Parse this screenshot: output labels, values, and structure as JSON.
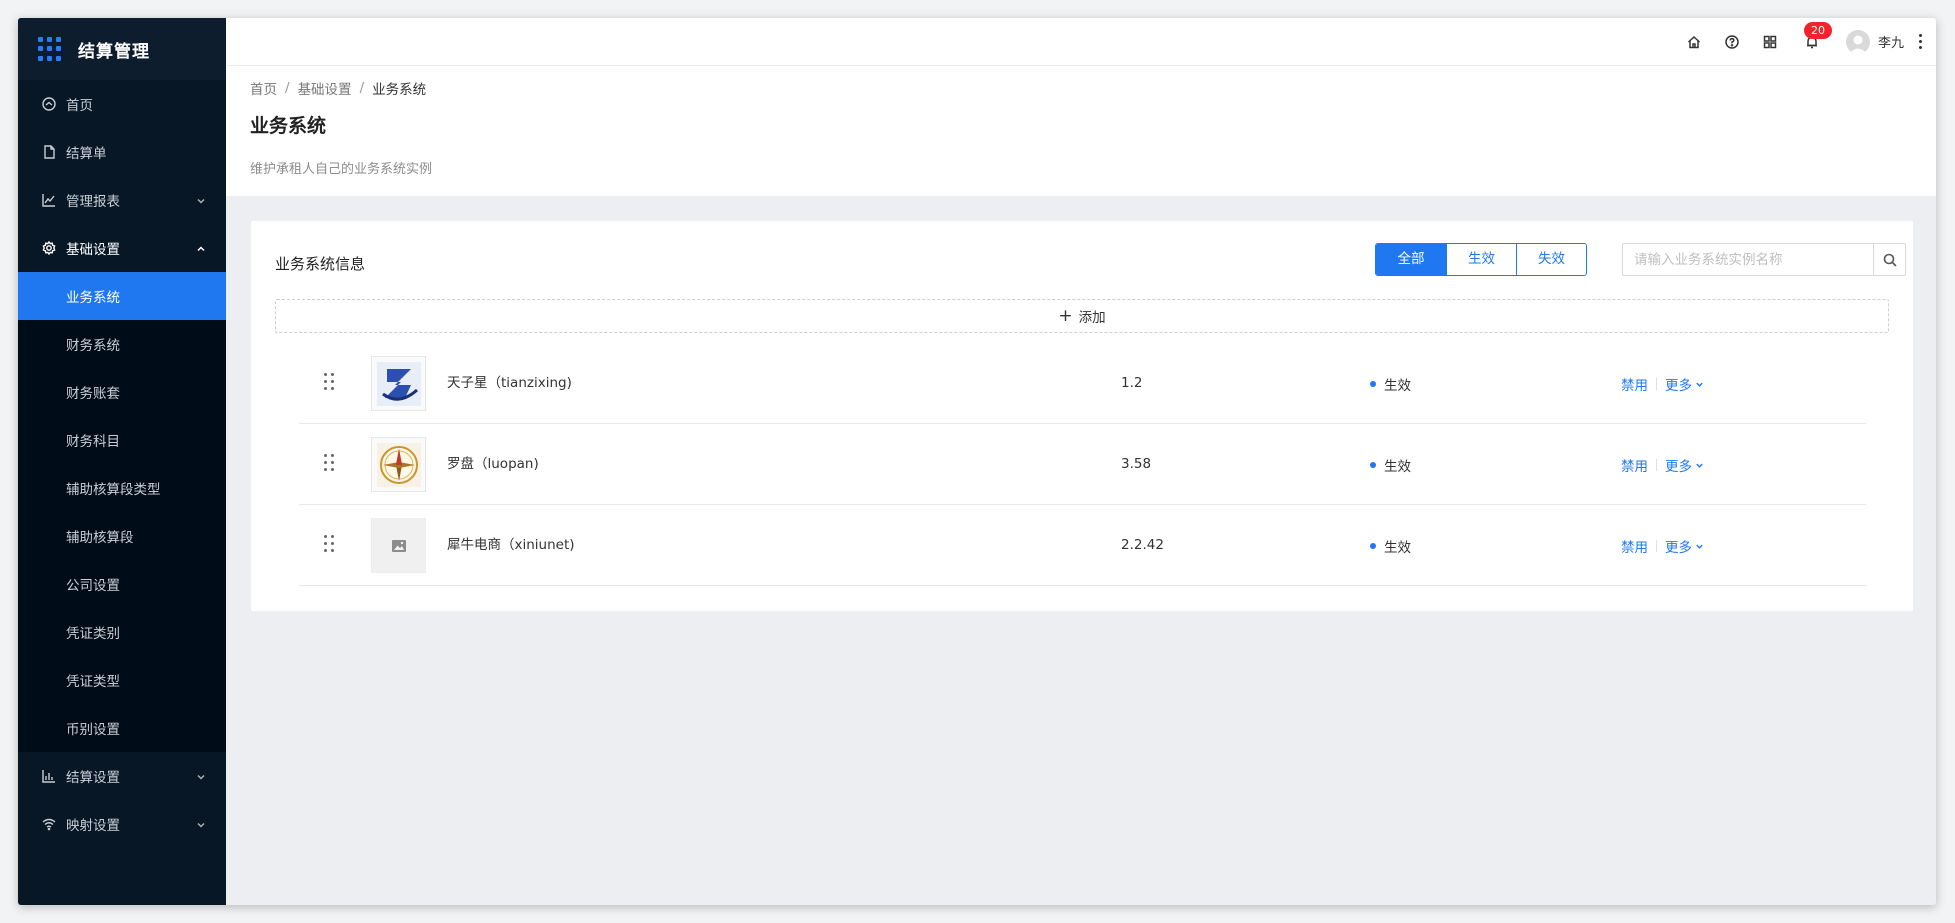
{
  "app": {
    "title": "结算管理"
  },
  "sidebar": {
    "items": [
      {
        "label": "首页",
        "icon": "dashboard-icon"
      },
      {
        "label": "结算单",
        "icon": "file-icon"
      },
      {
        "label": "管理报表",
        "icon": "line-chart-icon"
      },
      {
        "label": "基础设置",
        "icon": "gear-icon"
      },
      {
        "label": "结算设置",
        "icon": "bar-chart-icon"
      },
      {
        "label": "映射设置",
        "icon": "wifi-icon"
      }
    ],
    "submenu": [
      {
        "label": "业务系统",
        "active": true
      },
      {
        "label": "财务系统"
      },
      {
        "label": "财务账套"
      },
      {
        "label": "财务科目"
      },
      {
        "label": "辅助核算段类型"
      },
      {
        "label": "辅助核算段"
      },
      {
        "label": "公司设置"
      },
      {
        "label": "凭证类别"
      },
      {
        "label": "凭证类型"
      },
      {
        "label": "币别设置"
      }
    ]
  },
  "topbar": {
    "notification_count": "20",
    "user_name": "李九"
  },
  "breadcrumb": [
    "首页",
    "基础设置",
    "业务系统"
  ],
  "breadcrumb_sep": "/",
  "page": {
    "title": "业务系统",
    "description": "维护承租人自己的业务系统实例"
  },
  "card": {
    "title": "业务系统信息",
    "filters": [
      "全部",
      "生效",
      "失效"
    ],
    "selected_filter": "全部",
    "search_placeholder": "请输入业务系统实例名称",
    "add_label": "添加",
    "rows": [
      {
        "name": "天子星（tianzixing)",
        "version": "1.2",
        "status": "生效",
        "action": "禁用",
        "more": "更多"
      },
      {
        "name": "罗盘（luopan)",
        "version": "3.58",
        "status": "生效",
        "action": "禁用",
        "more": "更多"
      },
      {
        "name": "犀牛电商（xiniunet)",
        "version": "2.2.42",
        "status": "生效",
        "action": "禁用",
        "more": "更多"
      }
    ]
  },
  "colors": {
    "primary": "#1f78f0",
    "sidebar_bg": "#081726",
    "badge": "#f5222d"
  }
}
